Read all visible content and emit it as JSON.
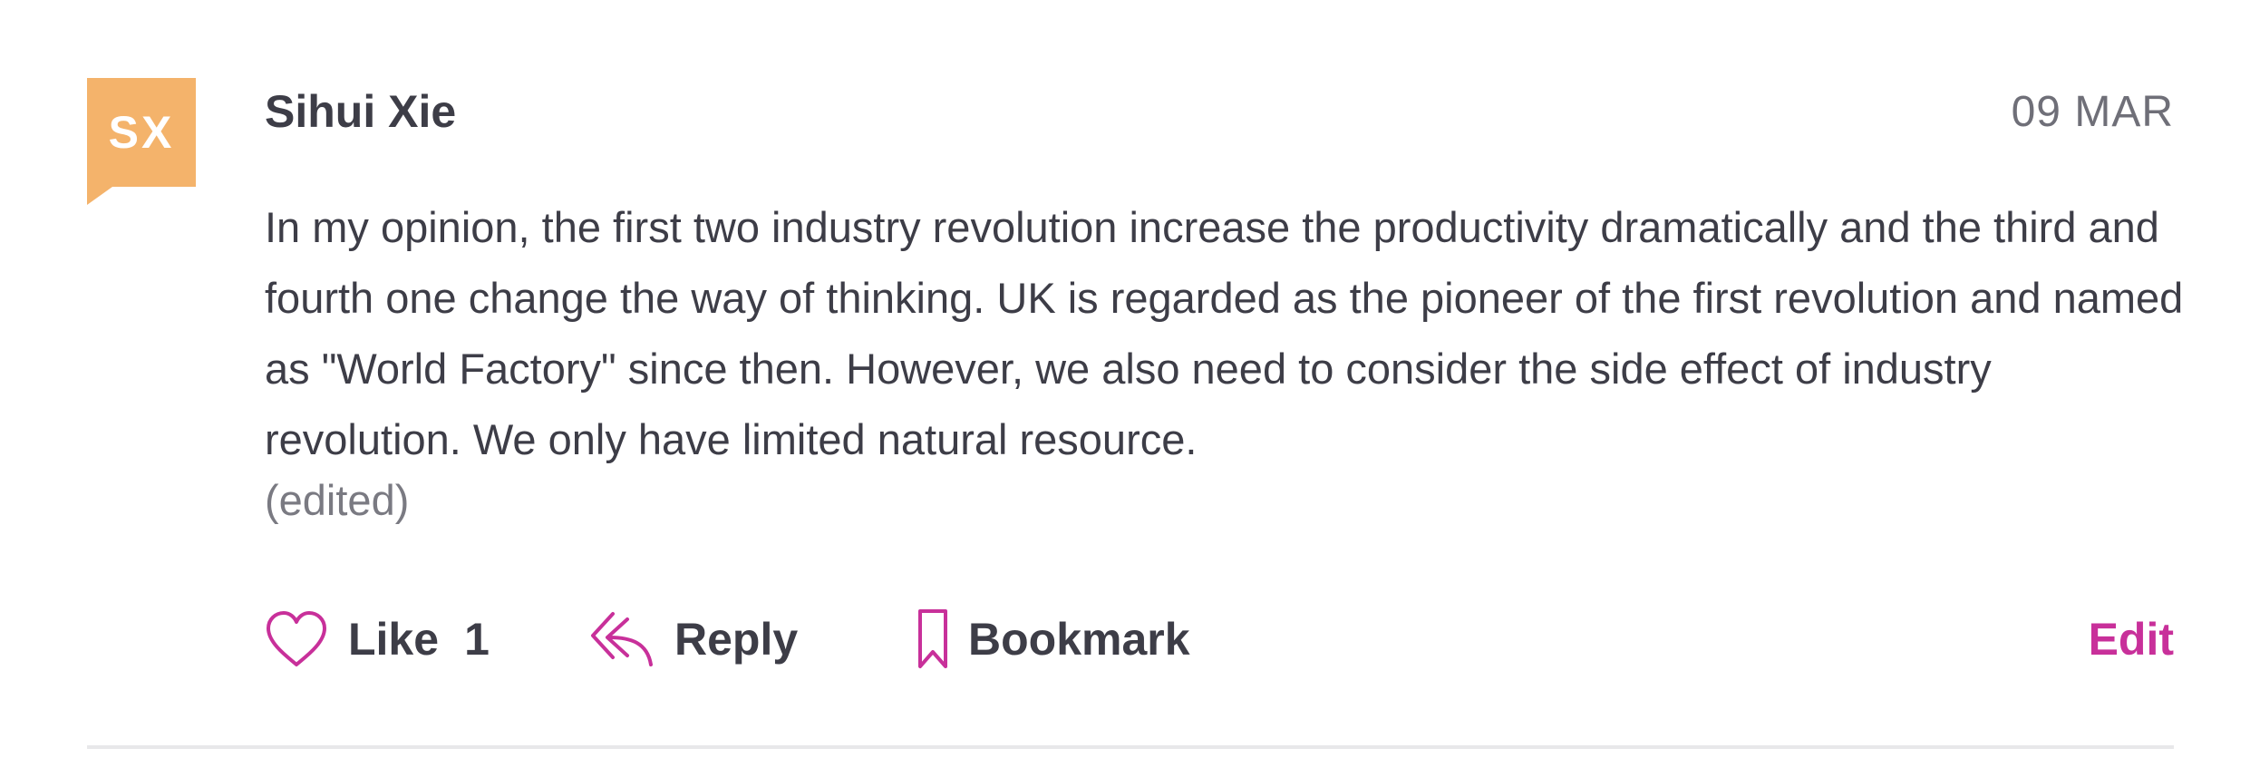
{
  "comment": {
    "avatar_initials": "SX",
    "author": "Sihui Xie",
    "date": "09 MAR",
    "text": "In my opinion, the first two industry revolution increase the productivity dramatically and the third and fourth one change the way of thinking. UK is regarded as the pioneer of the first revolution and named as \"World Factory\" since then. However, we also need to consider the side effect of industry revolution. We only have limited natural resource.",
    "edited_label": "(edited)"
  },
  "actions": {
    "like_label": "Like",
    "like_count": "1",
    "reply_label": "Reply",
    "bookmark_label": "Bookmark",
    "edit_label": "Edit"
  },
  "icons": {
    "like": "heart-icon",
    "reply": "reply-arrow-icon",
    "bookmark": "bookmark-icon"
  },
  "colors": {
    "avatar_bg": "#f4b36b",
    "accent": "#c8309a",
    "text": "#3d3d47",
    "muted": "#6f6f78"
  }
}
